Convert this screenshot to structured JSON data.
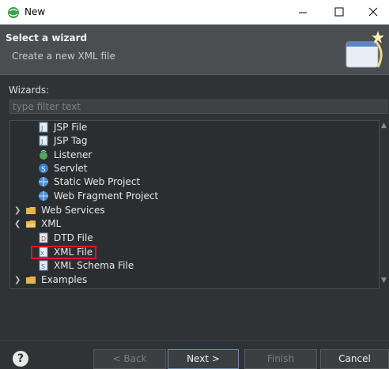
{
  "window": {
    "title": "New"
  },
  "header": {
    "title": "Select a wizard",
    "description": "Create a new XML file"
  },
  "wizards_label": "Wizards:",
  "filter": {
    "placeholder": "type filter text"
  },
  "tree": {
    "items": [
      {
        "label": "JSP File",
        "icon": "jsp-file-icon"
      },
      {
        "label": "JSP Tag",
        "icon": "jsp-tag-icon"
      },
      {
        "label": "Listener",
        "icon": "listener-icon"
      },
      {
        "label": "Servlet",
        "icon": "servlet-icon"
      },
      {
        "label": "Static Web Project",
        "icon": "static-web-project-icon"
      },
      {
        "label": "Web Fragment Project",
        "icon": "web-fragment-project-icon"
      },
      {
        "label": "Web Services",
        "icon": "folder-icon"
      },
      {
        "label": "XML",
        "icon": "folder-open-icon"
      },
      {
        "label": "DTD File",
        "icon": "dtd-file-icon"
      },
      {
        "label": "XML File",
        "icon": "xml-file-icon"
      },
      {
        "label": "XML Schema File",
        "icon": "xml-schema-file-icon"
      },
      {
        "label": "Examples",
        "icon": "folder-icon"
      }
    ]
  },
  "buttons": {
    "back": "< Back",
    "next": "Next >",
    "finish": "Finish",
    "cancel": "Cancel"
  },
  "colors": {
    "highlight": "#e0142a",
    "background": "#2f3336",
    "header": "#4a4e51"
  }
}
